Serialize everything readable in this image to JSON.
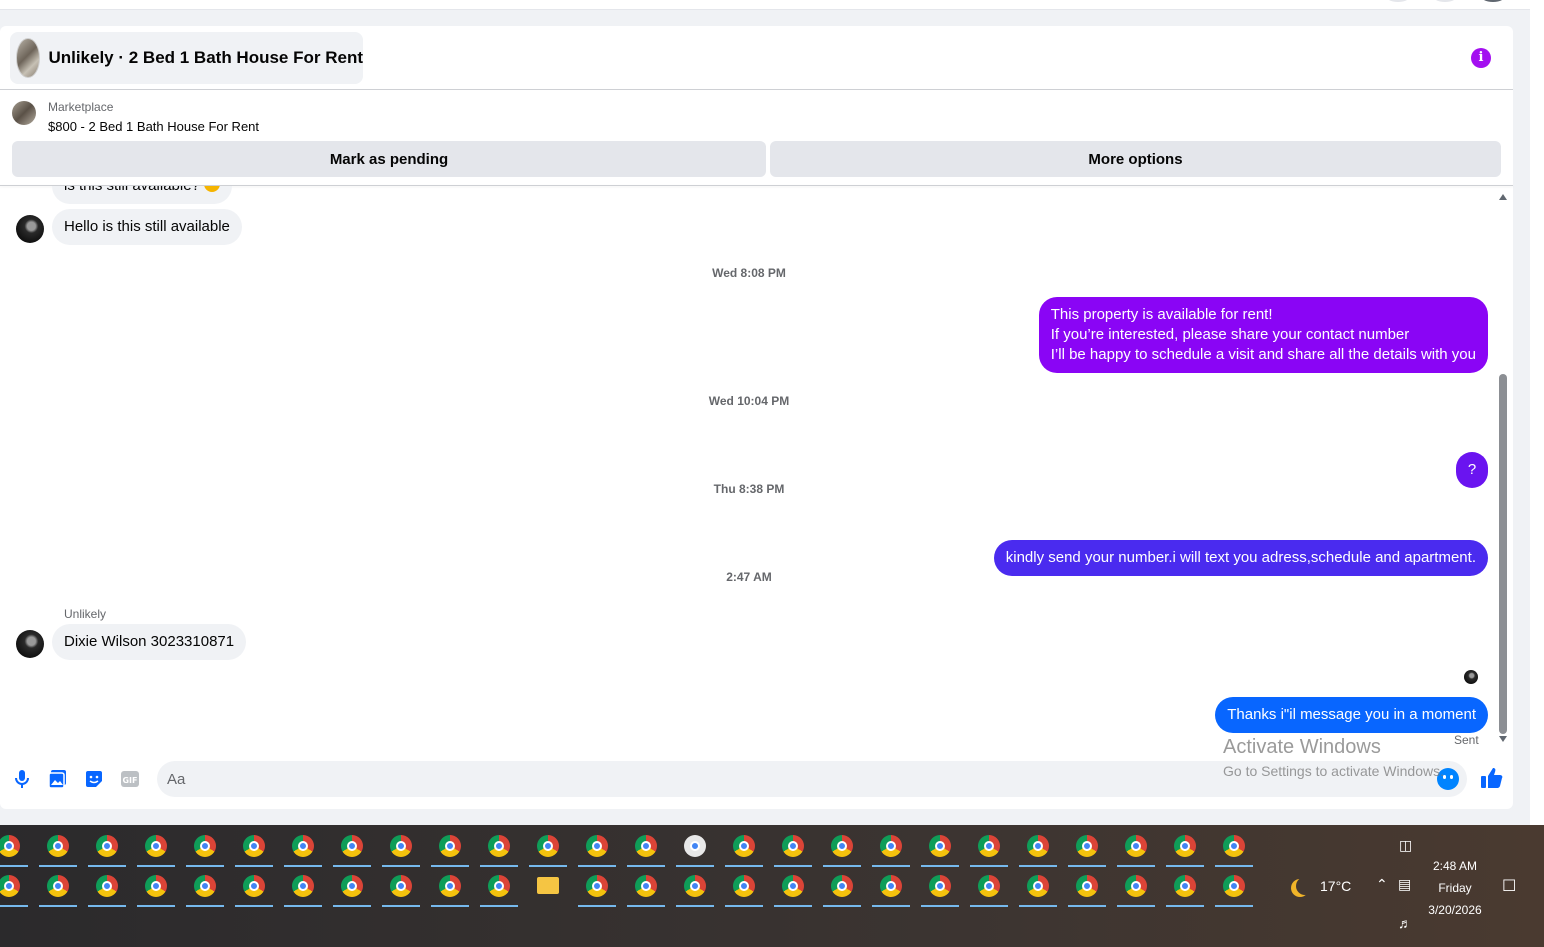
{
  "header": {
    "title": "Unlikely · 2 Bed 1 Bath House For Rent",
    "accent_color": "#a30ff0"
  },
  "listing": {
    "kicker": "Marketplace",
    "title": "$800 - 2 Bed 1 Bath House For Rent"
  },
  "actions": {
    "pending_label": "Mark as pending",
    "more_label": "More options"
  },
  "messages": {
    "partial_top": "is this still available?",
    "m1": "Hello is this still available",
    "ts1": "Wed 8:08 PM",
    "m2_line1": "This property is available for rent!",
    "m2_line2": "If you’re interested, please share your contact number",
    "m2_line3": "I’ll be happy to schedule a visit and share all the details with you",
    "ts2": "Wed 10:04 PM",
    "m3": "?",
    "ts3": "Thu 8:38 PM",
    "m4": "kindly send your number.i will text you adress,schedule and apartment.",
    "ts4": "2:47 AM",
    "sender_name": "Unlikely",
    "m5": "Dixie Wilson 3023310871",
    "m6": "Thanks i\"il message you in a moment",
    "sent_status": "Sent",
    "colors": {
      "purple": "#8a05f5",
      "violet": "#6a14f0",
      "indigo": "#4a2bef",
      "blue": "#0866ff"
    }
  },
  "composer": {
    "placeholder": "Aa",
    "value": ""
  },
  "watermark": {
    "line1": "Activate Windows",
    "line2": "Go to Settings to activate Windows."
  },
  "tray": {
    "weather": "17°C",
    "time": "2:48 AM",
    "day": "Friday",
    "date": "3/20/2026"
  },
  "taskbar": {
    "icon": "chrome-icon"
  }
}
